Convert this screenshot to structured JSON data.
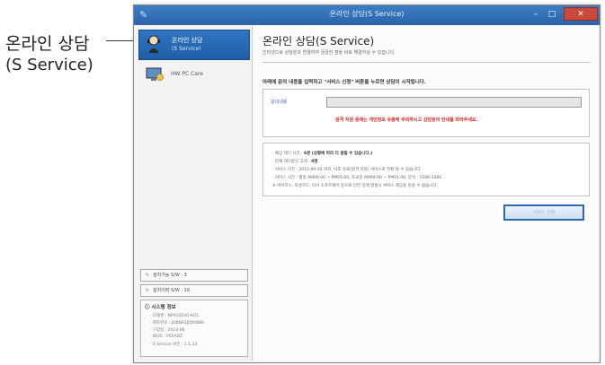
{
  "callout": {
    "title": "온라인 상담",
    "subtitle": "(S Service)"
  },
  "window": {
    "title": "온라인 상담(S Service)",
    "app_icon": "pencil-icon"
  },
  "sidebar": {
    "selected": {
      "label": "온라인 상담",
      "sublabel": "(S Service)",
      "icon": "headset-icon"
    },
    "item2": {
      "label": "HW PC Care",
      "icon": "pc-care-icon"
    },
    "btn1": "설치가능 S/W : 3",
    "btn2": "설치이력 S/W : 10",
    "sysinfo": {
      "title": "시스템 정보",
      "lines": [
        "· 모델명 : NP910S3G-K01",
        "· 제조번호 : JDBN91JD00889",
        "· 구입일 : 2014-06",
        "· BIOS : P05ADZ",
        "· S Service 버전 : 1.1.23"
      ]
    }
  },
  "main": {
    "title": "온라인 상담(S Service)",
    "desc": "인터넷으로 상담원과 연결하여 궁금한 점을 바로 해결하실 수 있습니다.",
    "instruction": "아래에 문의 내용을 입력하고 \"서비스 신청\" 버튼을 누르면 상담이 시작됩니다.",
    "field_label": "문의내용",
    "field_value": "",
    "warning": "원격 지원 중에는 개인정보 유출에 주의하시고 상담원의 안내를 따라주세요.",
    "info": {
      "wait_prefix": "· 예상 대기 시간 : ",
      "wait_value": "6분 (상황에 따라 더 걸릴 수 있습니다.)",
      "queue_prefix": "· 현재 대기중인 고객 : ",
      "queue_value": "0명",
      "line3": "· 서비스 기간 : 2015-09-30 까지, 이후 유료(원격 지원) 서비스로 전환 될 수 있습니다.",
      "line4": "· 서비스 시간 : 평일 AM09:00 ~ PM05:00, 토요일 AM09:00 ~ PM01:00, 문의 : 1588-3366",
      "line5": "※ 바이러스, 악성코드, 타사 소프트웨어 등으로 인한 장애 발생시 서비스 제공을 받을 수 없습니다."
    },
    "submit_label": "서비스 신청"
  }
}
